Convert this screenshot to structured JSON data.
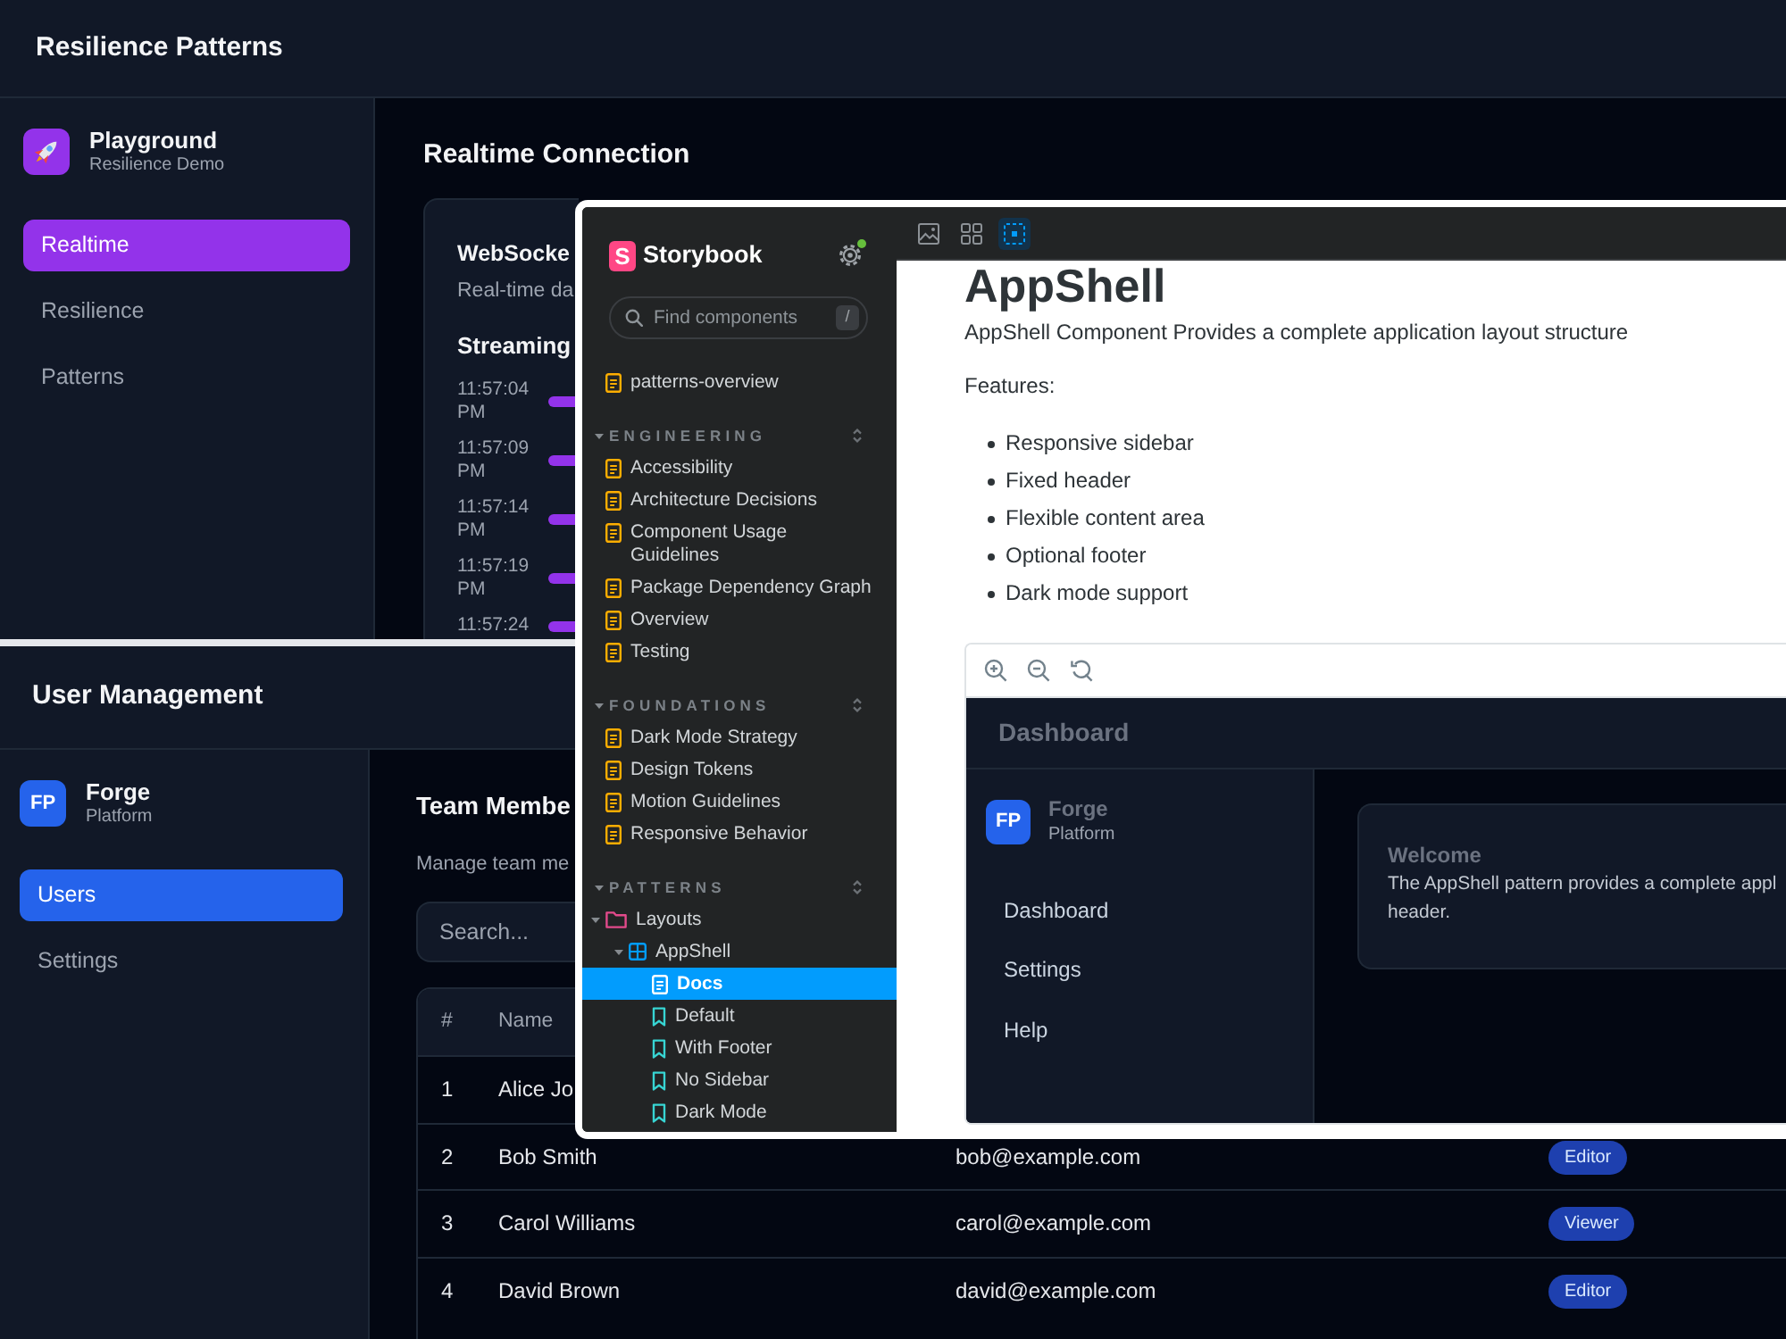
{
  "resilience_app": {
    "title": "Resilience Patterns",
    "brand": {
      "name": "Playground",
      "subtitle": "Resilience Demo"
    },
    "nav": [
      {
        "label": "Realtime",
        "selected": true
      },
      {
        "label": "Resilience",
        "selected": false
      },
      {
        "label": "Patterns",
        "selected": false
      }
    ],
    "page_title": "Realtime Connection",
    "card": {
      "title": "WebSocke",
      "subtitle": "Real-time da",
      "section_title": "Streaming",
      "events": [
        {
          "time": "11:57:04 PM"
        },
        {
          "time": "11:57:09 PM"
        },
        {
          "time": "11:57:14 PM"
        },
        {
          "time": "11:57:19 PM"
        },
        {
          "time": "11:57:24"
        }
      ]
    }
  },
  "user_app": {
    "title": "User Management",
    "brand": {
      "initials": "FP",
      "name": "Forge",
      "subtitle": "Platform"
    },
    "nav": [
      {
        "label": "Users",
        "selected": true
      },
      {
        "label": "Settings",
        "selected": false
      }
    ],
    "page_title": "Team Membe",
    "page_subtitle": "Manage team me",
    "search": {
      "placeholder": "Search..."
    },
    "table": {
      "columns": [
        "#",
        "Name"
      ],
      "rows": [
        {
          "number": "1",
          "name": "Alice Jo"
        },
        {
          "number": "2",
          "name": "Bob Smith",
          "email": "bob@example.com",
          "role": "Editor"
        },
        {
          "number": "3",
          "name": "Carol Williams",
          "email": "carol@example.com",
          "role": "Viewer"
        },
        {
          "number": "4",
          "name": "David Brown",
          "email": "david@example.com",
          "role": "Editor"
        }
      ]
    }
  },
  "storybook": {
    "logo_mark": "S",
    "title": "Storybook",
    "settings_badge": true,
    "search": {
      "placeholder": "Find components",
      "shortcut": "/"
    },
    "tree": [
      {
        "kind": "doc",
        "label": "patterns-overview",
        "selected": false
      }
    ],
    "sections": [
      {
        "title": "ENGINEERING",
        "expanded": true,
        "items": [
          {
            "kind": "doc",
            "label": "Accessibility",
            "selected": false
          },
          {
            "kind": "doc",
            "label": "Architecture Decisions",
            "selected": false
          },
          {
            "kind": "doc",
            "label": "Component Usage Guidelines",
            "selected": false
          },
          {
            "kind": "doc",
            "label": "Package Dependency Graph",
            "selected": false
          },
          {
            "kind": "doc",
            "label": "Overview",
            "selected": false
          },
          {
            "kind": "doc",
            "label": "Testing",
            "selected": false
          }
        ]
      },
      {
        "title": "FOUNDATIONS",
        "expanded": true,
        "items": [
          {
            "kind": "doc",
            "label": "Dark Mode Strategy",
            "selected": false
          },
          {
            "kind": "doc",
            "label": "Design Tokens",
            "selected": false
          },
          {
            "kind": "doc",
            "label": "Motion Guidelines",
            "selected": false
          },
          {
            "kind": "doc",
            "label": "Responsive Behavior",
            "selected": false
          }
        ]
      },
      {
        "title": "PATTERNS",
        "expanded": true,
        "items": [
          {
            "kind": "folder",
            "label": "Layouts",
            "selected": false,
            "expanded": true,
            "children": [
              {
                "kind": "component",
                "label": "AppShell",
                "selected": false,
                "expanded": true,
                "children": [
                  {
                    "kind": "doc",
                    "label": "Docs",
                    "selected": true
                  },
                  {
                    "kind": "story",
                    "label": "Default",
                    "selected": false
                  },
                  {
                    "kind": "story",
                    "label": "With Footer",
                    "selected": false
                  },
                  {
                    "kind": "story",
                    "label": "No Sidebar",
                    "selected": false
                  },
                  {
                    "kind": "story",
                    "label": "Dark Mode",
                    "selected": false
                  }
                ]
              }
            ]
          }
        ]
      }
    ],
    "toolbar": [
      {
        "kind": "image",
        "selected": false
      },
      {
        "kind": "grid",
        "selected": false
      },
      {
        "kind": "outline",
        "selected": true
      }
    ],
    "doc": {
      "title": "AppShell",
      "description": "AppShell Component Provides a complete application layout structure",
      "features_label": "Features:",
      "features": [
        "Responsive sidebar",
        "Fixed header",
        "Flexible content area",
        "Optional footer",
        "Dark mode support"
      ]
    },
    "preview": {
      "header_title": "Dashboard",
      "brand": {
        "initials": "FP",
        "name": "Forge",
        "subtitle": "Platform"
      },
      "nav": [
        {
          "label": "Dashboard",
          "selected": false
        },
        {
          "label": "Settings",
          "selected": false
        },
        {
          "label": "Help",
          "selected": false
        }
      ],
      "card": {
        "title": "Welcome",
        "lines": [
          "The AppShell pattern provides a complete appl",
          "header."
        ]
      }
    }
  }
}
